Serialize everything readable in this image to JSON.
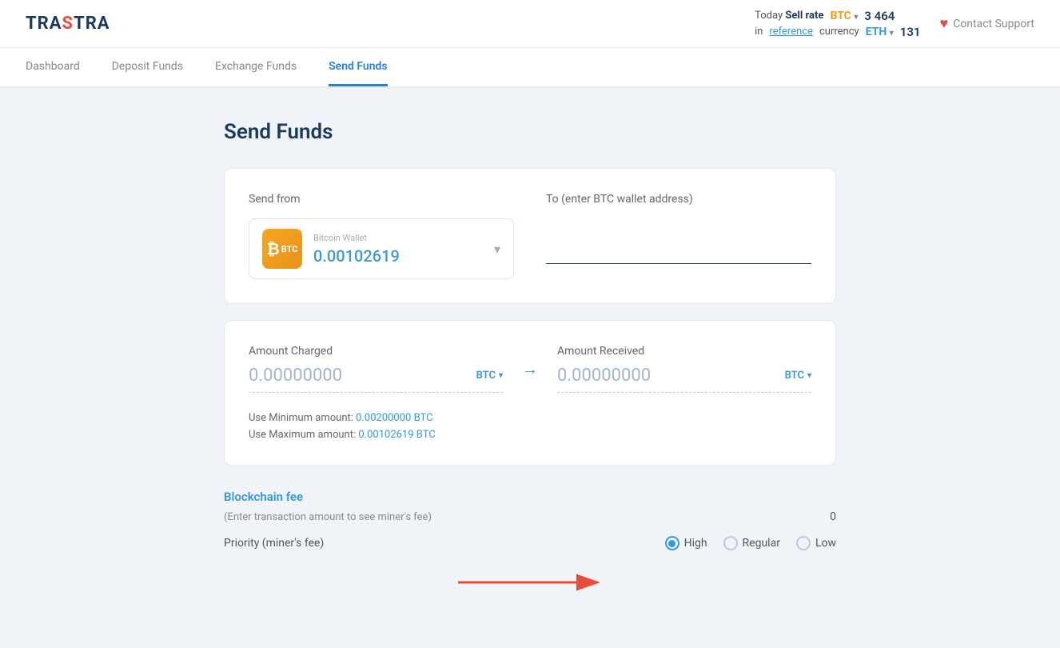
{
  "logo": {
    "part1": "TRA",
    "highlight": "S",
    "part2": "TRA"
  },
  "header": {
    "contact_support": "Contact Support",
    "sell_rate_label": "Today ",
    "sell_rate_bold": "Sell rate",
    "btc_currency": "BTC",
    "btc_value": "3 464",
    "in_text": "in ",
    "reference_text": "reference",
    "currency_text": " currency",
    "eth_currency": "ETH",
    "eth_value": "131"
  },
  "nav": {
    "items": [
      {
        "label": "Dashboard",
        "active": false
      },
      {
        "label": "Deposit Funds",
        "active": false
      },
      {
        "label": "Exchange Funds",
        "active": false
      },
      {
        "label": "Send Funds",
        "active": true
      }
    ]
  },
  "page": {
    "title": "Send Funds"
  },
  "send_from": {
    "label": "Send from",
    "wallet_type": "Bitcoin Wallet",
    "wallet_balance": "0.00102619",
    "wallet_ticker": "BTC"
  },
  "send_to": {
    "label": "To (enter BTC wallet address)",
    "placeholder": ""
  },
  "amount_charged": {
    "label": "Amount Charged",
    "value": "0.00000000",
    "currency": "BTC"
  },
  "amount_received": {
    "label": "Amount Received",
    "value": "0.00000000",
    "currency": "BTC"
  },
  "limits": {
    "min_label": "Use Minimum amount:",
    "min_value": "0.00200000 BTC",
    "max_label": "Use Maximum amount:",
    "max_value": "0.00102619 BTC"
  },
  "blockchain_fee": {
    "title": "Blockchain fee",
    "description": "(Enter transaction amount to see miner's fee)",
    "value": "0"
  },
  "priority": {
    "label": "Priority (miner's fee)",
    "options": [
      {
        "label": "High",
        "checked": true
      },
      {
        "label": "Regular",
        "checked": false
      },
      {
        "label": "Low",
        "checked": false
      }
    ]
  }
}
